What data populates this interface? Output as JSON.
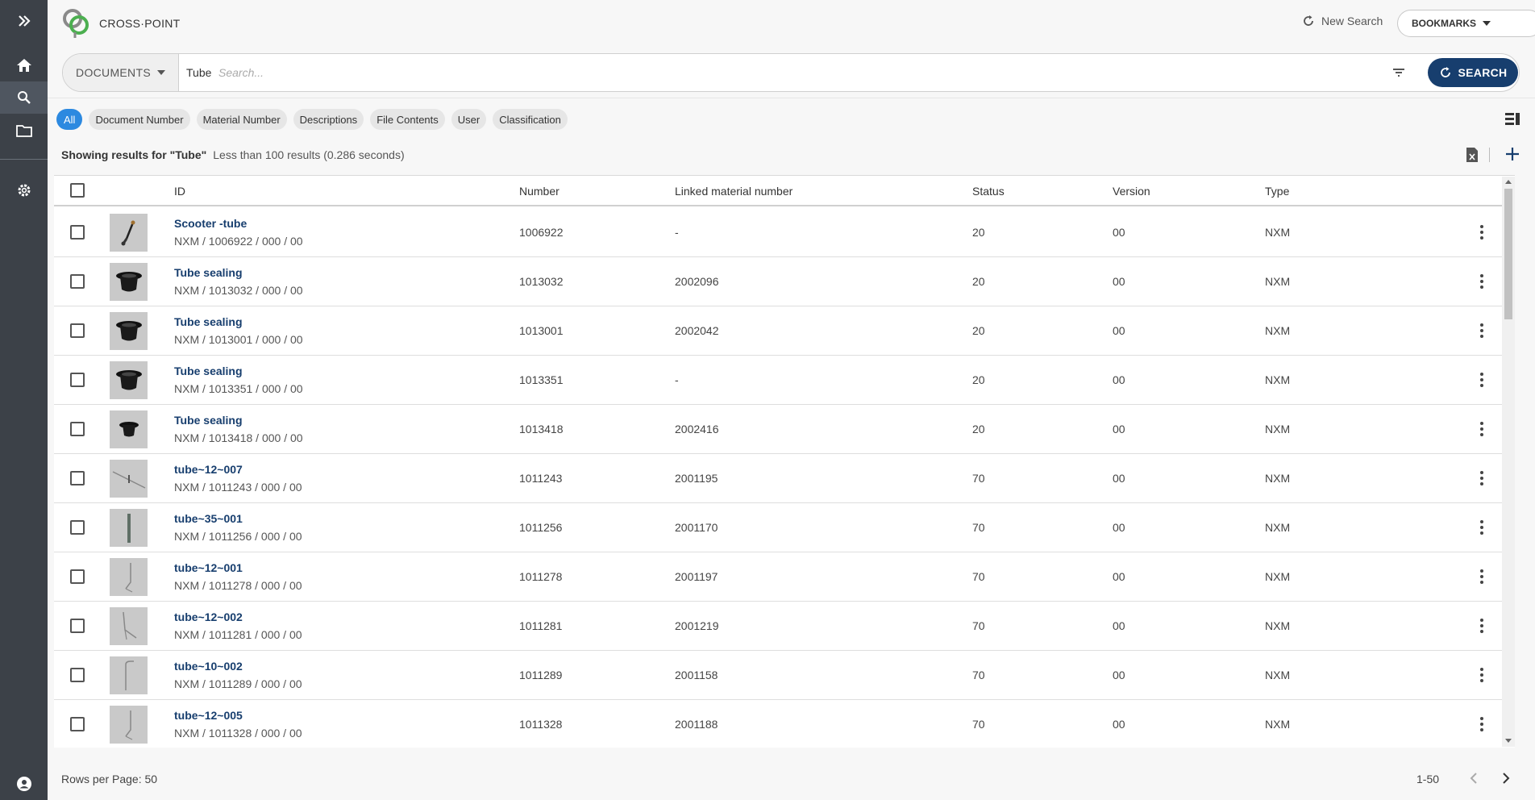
{
  "header": {
    "brand": "CROSS·POINT",
    "new_search": "New Search",
    "bookmarks": "BOOKMARKS"
  },
  "search": {
    "scope": "DOCUMENTS",
    "query": "Tube",
    "placeholder": "Search...",
    "button": "SEARCH"
  },
  "filters": [
    "All",
    "Document Number",
    "Material Number",
    "Descriptions",
    "File Contents",
    "User",
    "Classification"
  ],
  "summary": {
    "showing": "Showing results for \"Tube\"",
    "meta": "Less than 100 results (0.286 seconds)"
  },
  "columns": {
    "id": "ID",
    "number": "Number",
    "linked": "Linked material number",
    "status": "Status",
    "version": "Version",
    "type": "Type"
  },
  "rows": [
    {
      "title": "Scooter -tube",
      "sub": "NXM / 1006922 / 000 / 00",
      "number": "1006922",
      "linked": "-",
      "status": "20",
      "version": "00",
      "type": "NXM",
      "thumb": "scooter"
    },
    {
      "title": "Tube sealing",
      "sub": "NXM / 1013032 / 000 / 00",
      "number": "1013032",
      "linked": "2002096",
      "status": "20",
      "version": "00",
      "type": "NXM",
      "thumb": "sealing"
    },
    {
      "title": "Tube sealing",
      "sub": "NXM / 1013001 / 000 / 00",
      "number": "1013001",
      "linked": "2002042",
      "status": "20",
      "version": "00",
      "type": "NXM",
      "thumb": "sealing"
    },
    {
      "title": "Tube sealing",
      "sub": "NXM / 1013351 / 000 / 00",
      "number": "1013351",
      "linked": "-",
      "status": "20",
      "version": "00",
      "type": "NXM",
      "thumb": "sealing"
    },
    {
      "title": "Tube sealing",
      "sub": "NXM / 1013418 / 000 / 00",
      "number": "1013418",
      "linked": "2002416",
      "status": "20",
      "version": "00",
      "type": "NXM",
      "thumb": "sealing-small"
    },
    {
      "title": "tube~12~007",
      "sub": "NXM / 1011243 / 000 / 00",
      "number": "1011243",
      "linked": "2001195",
      "status": "70",
      "version": "00",
      "type": "NXM",
      "thumb": "diag"
    },
    {
      "title": "tube~35~001",
      "sub": "NXM / 1011256 / 000 / 00",
      "number": "1011256",
      "linked": "2001170",
      "status": "70",
      "version": "00",
      "type": "NXM",
      "thumb": "vert"
    },
    {
      "title": "tube~12~001",
      "sub": "NXM / 1011278 / 000 / 00",
      "number": "1011278",
      "linked": "2001197",
      "status": "70",
      "version": "00",
      "type": "NXM",
      "thumb": "bent"
    },
    {
      "title": "tube~12~002",
      "sub": "NXM / 1011281 / 000 / 00",
      "number": "1011281",
      "linked": "2001219",
      "status": "70",
      "version": "00",
      "type": "NXM",
      "thumb": "bent2"
    },
    {
      "title": "tube~10~002",
      "sub": "NXM / 1011289 / 000 / 00",
      "number": "1011289",
      "linked": "2001158",
      "status": "70",
      "version": "00",
      "type": "NXM",
      "thumb": "hook"
    },
    {
      "title": "tube~12~005",
      "sub": "NXM / 1011328 / 000 / 00",
      "number": "1011328",
      "linked": "2001188",
      "status": "70",
      "version": "00",
      "type": "NXM",
      "thumb": "bent"
    },
    {
      "title": "",
      "sub": "",
      "number": "",
      "linked": "",
      "status": "",
      "version": "",
      "type": "",
      "thumb": "blank"
    }
  ],
  "footer": {
    "rows_per_page": "Rows per Page: 50",
    "range": "1-50"
  },
  "icons": {
    "rail": [
      "chevrons-right-icon",
      "home-icon",
      "search-icon",
      "folder-icon",
      "gear-icon",
      "account-icon"
    ],
    "header": [
      "logo-icon",
      "refresh-icon",
      "caret-down-icon",
      "plus-circle-icon"
    ],
    "toolbar": [
      "filter-icon",
      "layout-icon",
      "excel-export-icon",
      "plus-icon",
      "more-vert-icon",
      "chevron-left-icon",
      "chevron-right-icon"
    ]
  },
  "colors": {
    "rail": "#3c4148",
    "accent": "#173e6e",
    "chip_active": "#2c89e0"
  }
}
